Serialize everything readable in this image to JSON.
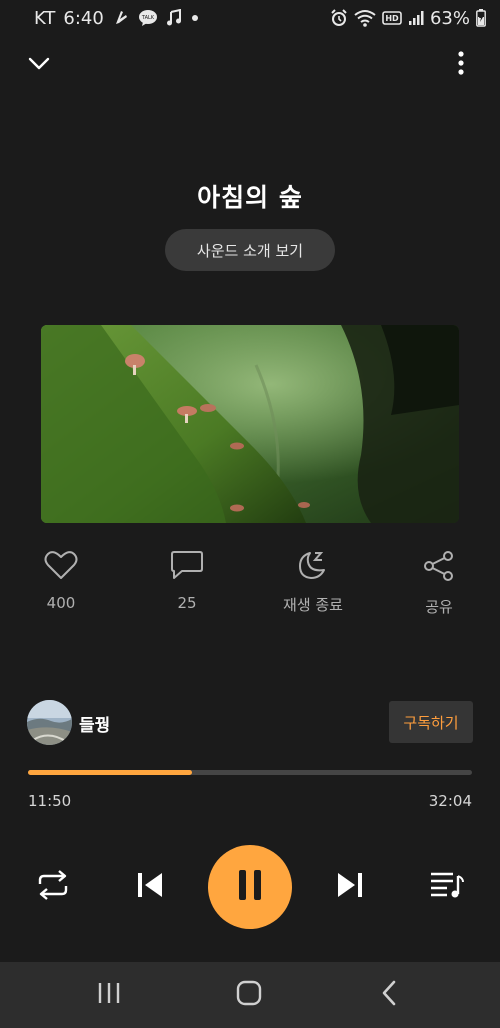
{
  "status_bar": {
    "carrier": "KT",
    "time": "6:40",
    "battery": "63%",
    "icons": [
      "music-app-icon",
      "talk-icon",
      "music-note-icon",
      "dot-icon",
      "alarm-icon",
      "wifi-icon",
      "hd-icon",
      "signal-icon",
      "battery-icon"
    ]
  },
  "top_bar": {
    "icons": [
      "chevron-down-icon",
      "more-vertical-icon"
    ]
  },
  "track": {
    "title": "아침의 숲",
    "intro_button": "사운드 소개 보기"
  },
  "actions": [
    {
      "icon": "heart-icon",
      "label": "400"
    },
    {
      "icon": "comment-icon",
      "label": "25"
    },
    {
      "icon": "sleep-timer-icon",
      "label": "재생 종료"
    },
    {
      "icon": "share-icon",
      "label": "공유"
    }
  ],
  "author": {
    "name": "들꿩",
    "subscribe_label": "구독하기"
  },
  "playback": {
    "current_time": "11:50",
    "total_time": "32:04",
    "progress": 0.369
  },
  "controls": {
    "icons": [
      "repeat-icon",
      "previous-icon",
      "pause-icon",
      "next-icon",
      "playlist-icon"
    ]
  },
  "nav_bar": {
    "icons": [
      "recent-apps-icon",
      "home-icon",
      "back-icon"
    ]
  },
  "colors": {
    "accent": "#ffa63f",
    "background": "#1b1b1b",
    "subscribe_text": "#ff9e3d"
  }
}
